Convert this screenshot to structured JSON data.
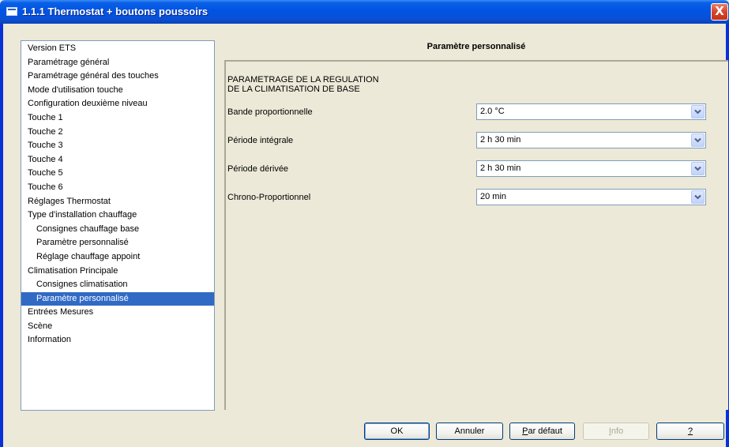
{
  "window": {
    "title": "1.1.1 Thermostat + boutons poussoirs",
    "close_symbol": "X"
  },
  "tree": {
    "items": [
      {
        "label": "Version ETS",
        "level": 0,
        "selected": false
      },
      {
        "label": "Paramétrage général",
        "level": 0,
        "selected": false
      },
      {
        "label": "Paramétrage général des touches",
        "level": 0,
        "selected": false
      },
      {
        "label": "Mode d'utilisation touche",
        "level": 0,
        "selected": false
      },
      {
        "label": "Configuration deuxième niveau",
        "level": 0,
        "selected": false
      },
      {
        "label": "Touche 1",
        "level": 0,
        "selected": false
      },
      {
        "label": "Touche 2",
        "level": 0,
        "selected": false
      },
      {
        "label": "Touche 3",
        "level": 0,
        "selected": false
      },
      {
        "label": "Touche 4",
        "level": 0,
        "selected": false
      },
      {
        "label": "Touche 5",
        "level": 0,
        "selected": false
      },
      {
        "label": "Touche 6",
        "level": 0,
        "selected": false
      },
      {
        "label": "Réglages Thermostat",
        "level": 0,
        "selected": false
      },
      {
        "label": "Type d'installation chauffage",
        "level": 0,
        "selected": false
      },
      {
        "label": "Consignes chauffage base",
        "level": 1,
        "selected": false
      },
      {
        "label": "Paramètre personnalisé",
        "level": 1,
        "selected": false
      },
      {
        "label": "Réglage chauffage appoint",
        "level": 1,
        "selected": false
      },
      {
        "label": "Climatisation Principale",
        "level": 0,
        "selected": false
      },
      {
        "label": "Consignes climatisation",
        "level": 1,
        "selected": false
      },
      {
        "label": "Paramètre personnalisé",
        "level": 1,
        "selected": true
      },
      {
        "label": "Entrées Mesures",
        "level": 0,
        "selected": false
      },
      {
        "label": "Scène",
        "level": 0,
        "selected": false
      },
      {
        "label": "Information",
        "level": 0,
        "selected": false
      }
    ]
  },
  "panel": {
    "header": "Paramètre personnalisé",
    "section_title_line1": "PARAMETRAGE DE LA REGULATION",
    "section_title_line2": "DE LA CLIMATISATION DE BASE",
    "params": [
      {
        "label": "Bande proportionnelle",
        "value": "2.0 °C"
      },
      {
        "label": "Période intégrale",
        "value": "2 h 30 min"
      },
      {
        "label": "Période dérivée",
        "value": "2 h 30 min"
      },
      {
        "label": "Chrono-Proportionnel",
        "value": "20 min"
      }
    ]
  },
  "buttons": {
    "ok": "OK",
    "cancel": "Annuler",
    "default_first": "P",
    "default_rest": "ar défaut",
    "info_first": "I",
    "info_rest": "nfo",
    "help": "?"
  },
  "colors": {
    "selection": "#316ac5",
    "titlebar": "#0054e3",
    "dialog_bg": "#ece9d8"
  }
}
